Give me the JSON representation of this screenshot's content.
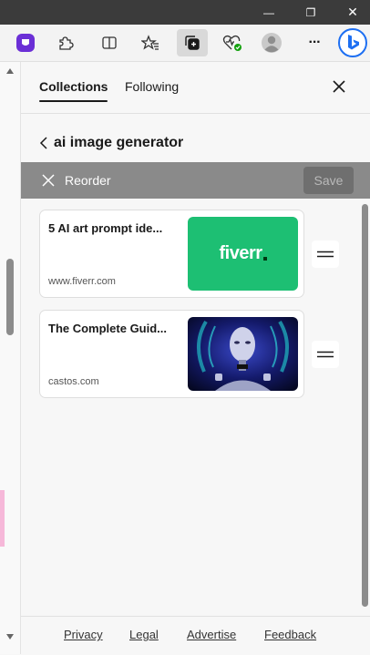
{
  "window": {
    "minimize_glyph": "—",
    "maximize_glyph": "❐",
    "close_glyph": "✕"
  },
  "toolbar": {
    "icons": [
      "extension-purple-icon",
      "puzzle-icon",
      "split-screen-icon",
      "favorites-icon",
      "collections-icon",
      "browser-essentials-icon",
      "profile-avatar",
      "more-icon",
      "bing-icon"
    ],
    "more_glyph": "···"
  },
  "panel": {
    "tabs": [
      {
        "label": "Collections",
        "active": true
      },
      {
        "label": "Following",
        "active": false
      }
    ],
    "collection_title": "ai image generator",
    "reorder": {
      "label": "Reorder",
      "save_label": "Save"
    },
    "items": [
      {
        "title": "5 AI art prompt ide...",
        "domain": "www.fiverr.com",
        "thumb": "fiverr"
      },
      {
        "title": "The Complete Guid...",
        "domain": "castos.com",
        "thumb": "cyborg"
      }
    ],
    "footer": {
      "links": [
        "Privacy",
        "Legal",
        "Advertise",
        "Feedback"
      ]
    }
  },
  "thumbnails": {
    "fiverr_text": "fiverr",
    "fiverr_color": "#1dbf73"
  },
  "colors": {
    "reorder_bar": "#8a8a8a",
    "title_bar": "#3b3b3b",
    "bing_blue": "#1d6ff2"
  }
}
